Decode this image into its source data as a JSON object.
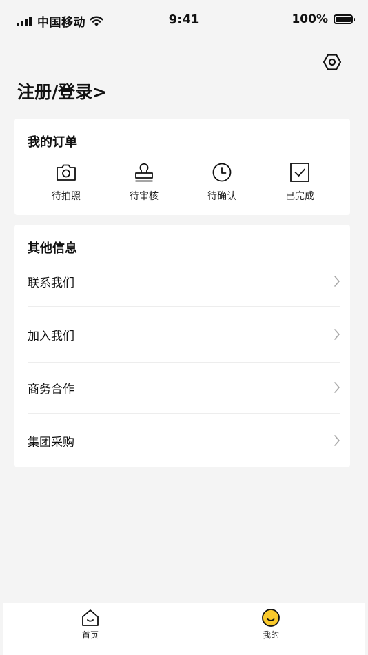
{
  "status_bar": {
    "carrier": "中国移动",
    "time": "9:41",
    "battery": "100%"
  },
  "header": {
    "login_label": "注册/登录>",
    "settings_icon": "hexagon-settings-icon"
  },
  "orders": {
    "title": "我的订单",
    "items": [
      {
        "label": "待拍照",
        "icon": "camera-icon"
      },
      {
        "label": "待审核",
        "icon": "stamp-icon"
      },
      {
        "label": "待确认",
        "icon": "clock-icon"
      },
      {
        "label": "已完成",
        "icon": "checkbox-icon"
      }
    ]
  },
  "other_info": {
    "title": "其他信息",
    "items": [
      {
        "label": "联系我们"
      },
      {
        "label": "加入我们"
      },
      {
        "label": "商务合作"
      },
      {
        "label": "集团采购"
      }
    ]
  },
  "tab_bar": {
    "tabs": [
      {
        "label": "首页",
        "icon": "home-icon"
      },
      {
        "label": "我的",
        "icon": "smiley-icon"
      }
    ],
    "active_color": "#f9c92b"
  }
}
